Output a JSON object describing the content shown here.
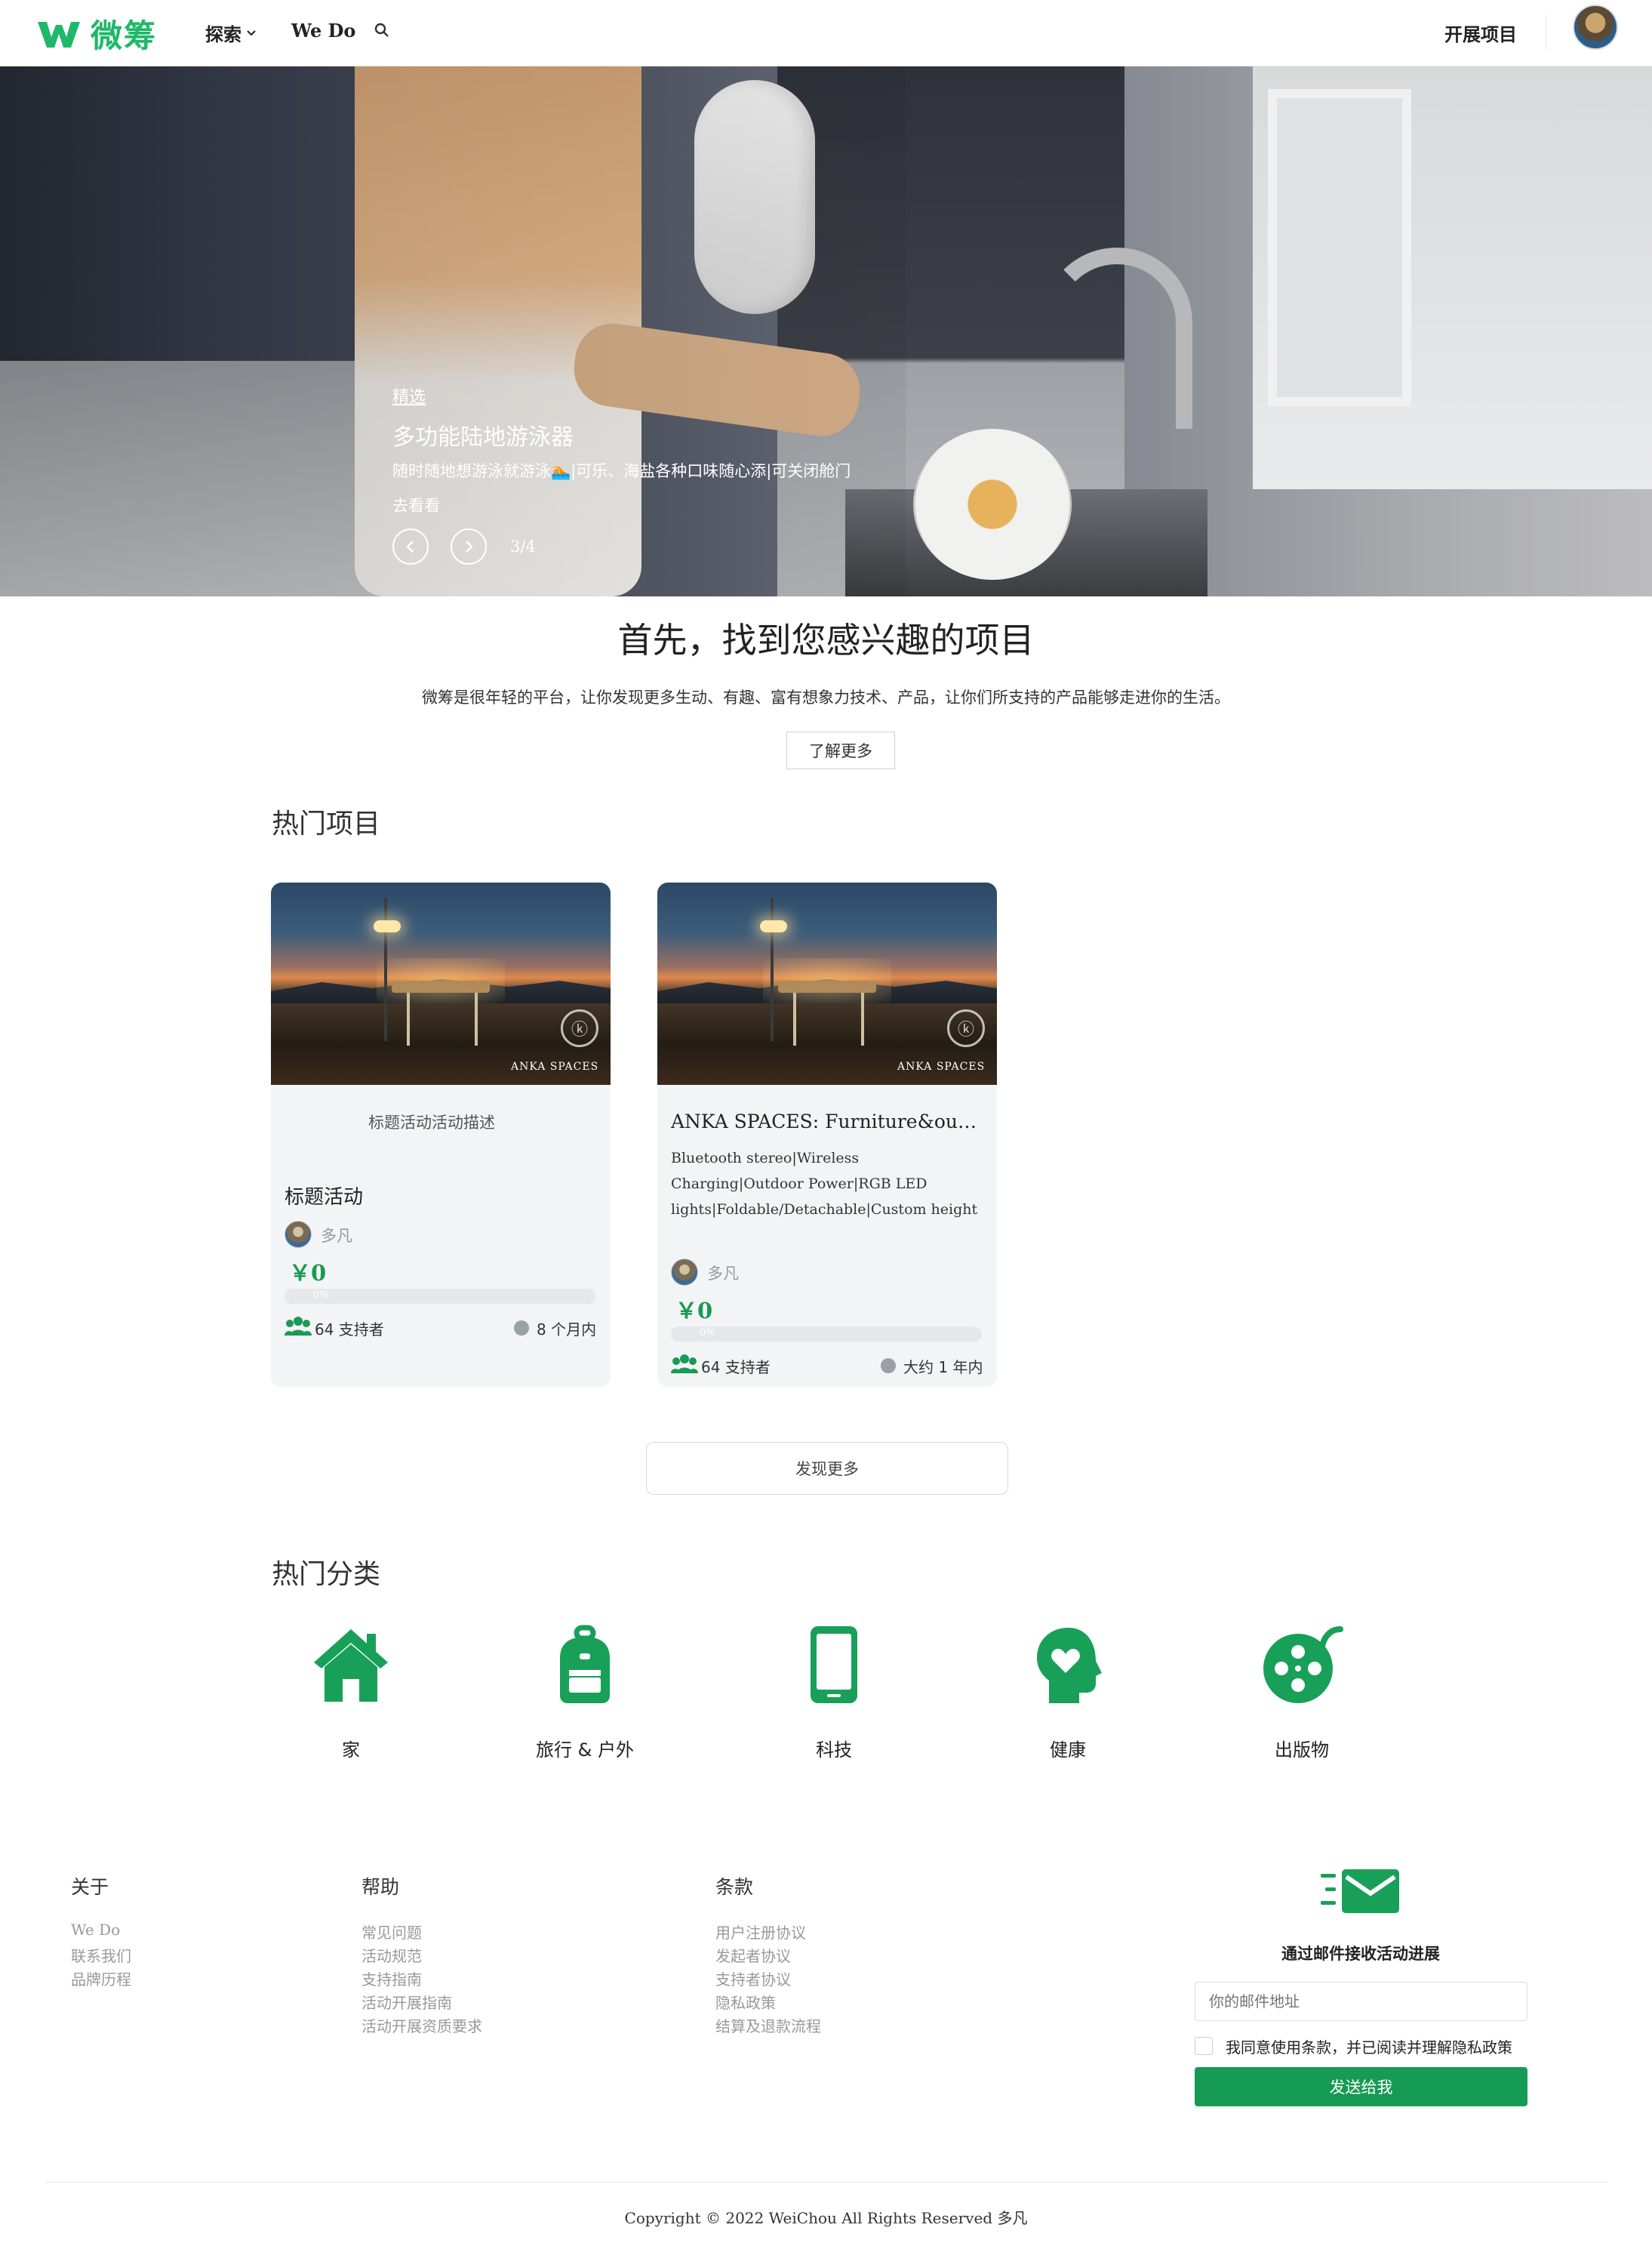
{
  "header": {
    "logo_text": "微筹",
    "nav_explore": "探索",
    "nav_wedo": "We Do",
    "start_project": "开展项目"
  },
  "hero": {
    "tag": "精选",
    "title": "多功能陆地游泳器",
    "description": "随时随地想游泳就游泳🏊|可乐、海盐各种口味随心添|可关闭舱门",
    "link": "去看看",
    "page": "3/4"
  },
  "intro": {
    "title": "首先，找到您感兴趣的项目",
    "description": "微筹是很年轻的平台，让你发现更多生动、有趣、富有想象力技术、产品，让你们所支持的产品能够走进你的生活。",
    "learn_more": "了解更多"
  },
  "hot_projects": {
    "title": "热门项目",
    "cards": [
      {
        "image_brand": "ANKA SPACES",
        "subtitle": "标题活动活动描述",
        "title": "标题活动",
        "description": "",
        "author": "多凡",
        "price": "￥0",
        "progress_percent": 0,
        "progress_label": "0%",
        "supporters": "64 支持者",
        "time": "8 个月内"
      },
      {
        "image_brand": "ANKA SPACES",
        "subtitle": "",
        "title": "ANKA SPACES: Furniture&outdoor...",
        "description": "Bluetooth stereo|Wireless Charging|Outdoor Power|RGB LED lights|Foldable/Detachable|Custom height",
        "author": "多凡",
        "price": "￥0",
        "progress_percent": 0,
        "progress_label": "0%",
        "supporters": "64 支持者",
        "time": "大约 1 年内"
      }
    ],
    "discover_more": "发现更多"
  },
  "categories": {
    "title": "热门分类",
    "items": [
      {
        "label": "家",
        "icon": "home-icon"
      },
      {
        "label": "旅行 & 户外",
        "icon": "backpack-icon"
      },
      {
        "label": "科技",
        "icon": "mobile-phone-icon"
      },
      {
        "label": "健康",
        "icon": "heart-head-icon"
      },
      {
        "label": "出版物",
        "icon": "film-reel-icon"
      }
    ]
  },
  "footer": {
    "about": {
      "title": "关于",
      "links": [
        "We Do",
        "联系我们",
        "品牌历程"
      ]
    },
    "help": {
      "title": "帮助",
      "links": [
        "常见问题",
        "活动规范",
        "支持指南",
        "活动开展指南",
        "活动开展资质要求"
      ]
    },
    "terms": {
      "title": "条款",
      "links": [
        "用户注册协议",
        "发起者协议",
        "支持者协议",
        "隐私政策",
        "结算及退款流程"
      ]
    },
    "newsletter": {
      "title": "通过邮件接收活动进展",
      "placeholder": "你的邮件地址",
      "agree": "我同意使用条款，并已阅读并理解隐私政策",
      "button": "发送给我"
    },
    "copyright": "Copyright © 2022 WeiChou All Rights Reserved 多凡"
  },
  "colors": {
    "brand_green": "#1fb86a",
    "button_green": "#169b55",
    "price_green": "#1a9a55"
  }
}
